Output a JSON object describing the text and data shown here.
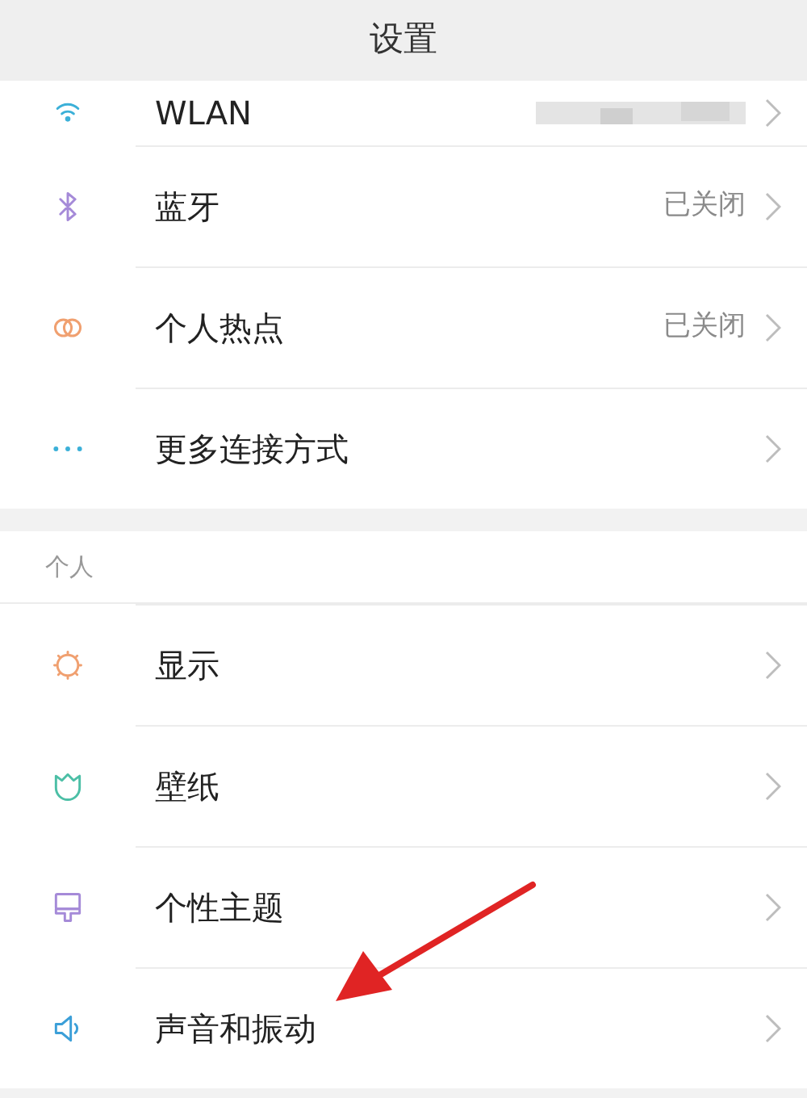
{
  "header": {
    "title": "设置"
  },
  "sections": [
    {
      "items": [
        {
          "label": "WLAN",
          "value_blurred": true
        },
        {
          "label": "蓝牙",
          "value_blurred": false,
          "value": "已关闭"
        },
        {
          "label": "个人热点",
          "value_blurred": false,
          "value": "已关闭"
        },
        {
          "label": "更多连接方式",
          "value_blurred": false
        }
      ]
    },
    {
      "title": "个人",
      "items": [
        {
          "label": "显示",
          "value_blurred": false
        },
        {
          "label": "壁纸",
          "value_blurred": false
        },
        {
          "label": "个性主题",
          "value_blurred": false
        },
        {
          "label": "声音和振动",
          "value_blurred": false
        }
      ]
    }
  ]
}
